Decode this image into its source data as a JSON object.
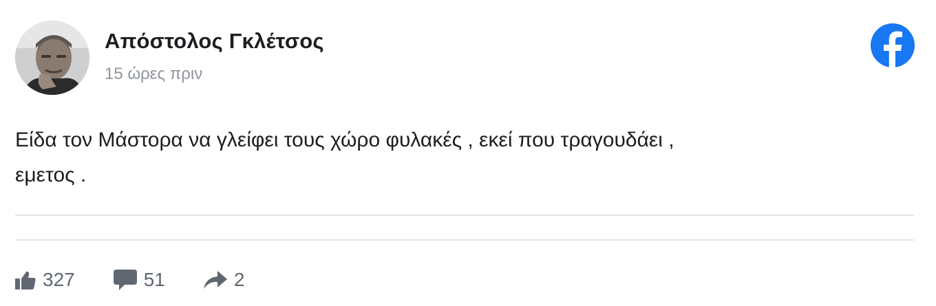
{
  "post": {
    "author": {
      "name": "Απόστολος Γκλέτσος",
      "avatar": "profile-photo"
    },
    "timestamp": "15 ώρες πριν",
    "text_line_1": "Είδα τον Μάστορα να γλείφει τους χώρο φυλακές , εκεί που τραγουδάει ,",
    "text_line_2": "εμετος .",
    "platform_icon": "facebook-logo-icon",
    "brand_color": "#1877f2"
  },
  "stats": {
    "likes": {
      "icon": "thumbs-up-icon",
      "count": "327"
    },
    "comments": {
      "icon": "comment-bubble-icon",
      "count": "51"
    },
    "shares": {
      "icon": "share-arrow-icon",
      "count": "2"
    }
  },
  "colors": {
    "text": "#1c1e21",
    "muted": "#90949c",
    "icon_gray": "#606770",
    "divider": "#e4e6eb"
  }
}
